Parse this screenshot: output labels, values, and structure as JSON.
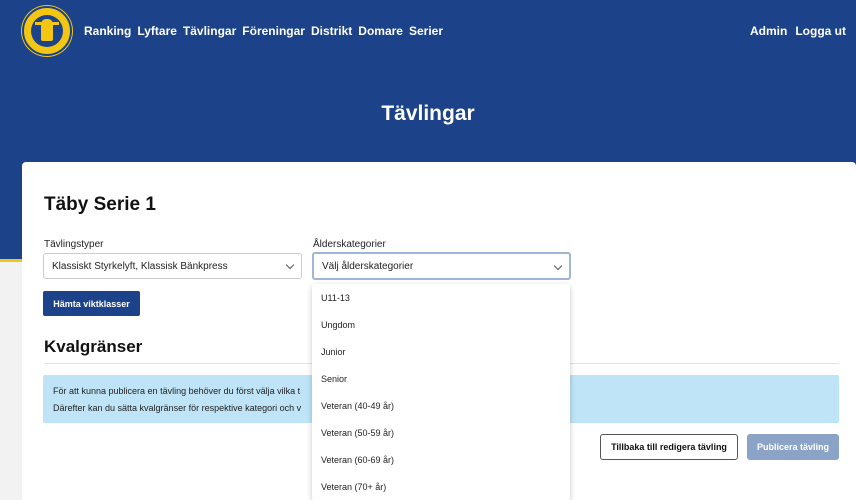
{
  "nav": {
    "links": [
      "Ranking",
      "Lyftare",
      "Tävlingar",
      "Föreningar",
      "Distrikt",
      "Domare",
      "Serier"
    ],
    "right": [
      "Admin",
      "Logga ut"
    ]
  },
  "hero": {
    "title": "Tävlingar"
  },
  "competition": {
    "title": "Täby Serie 1"
  },
  "filters": {
    "types_label": "Tävlingstyper",
    "types_value": "Klassiskt Styrkelyft, Klassisk Bänkpress",
    "age_label": "Ålderskategorier",
    "age_placeholder": "Välj ålderskategorier"
  },
  "fetch_button": "Hämta viktklasser",
  "qualification": {
    "title": "Kvalgränser",
    "info_line1": "För att kunna publicera en tävling behöver du först välja vilka t",
    "info_line2": "Därefter kan du sätta kvalgränser för respektive kategori och v"
  },
  "actions": {
    "back": "Tillbaka till redigera tävling",
    "publish": "Publicera tävling"
  },
  "age_options": [
    "U11-13",
    "Ungdom",
    "Junior",
    "Senior",
    "Veteran (40-49 år)",
    "Veteran (50-59 år)",
    "Veteran (60-69 år)",
    "Veteran (70+ år)"
  ],
  "colors": {
    "brand_blue": "#1c428a",
    "brand_gold": "#f3c614",
    "info_bg": "#bfe4f8",
    "publish_disabled": "#8aa3c7"
  }
}
